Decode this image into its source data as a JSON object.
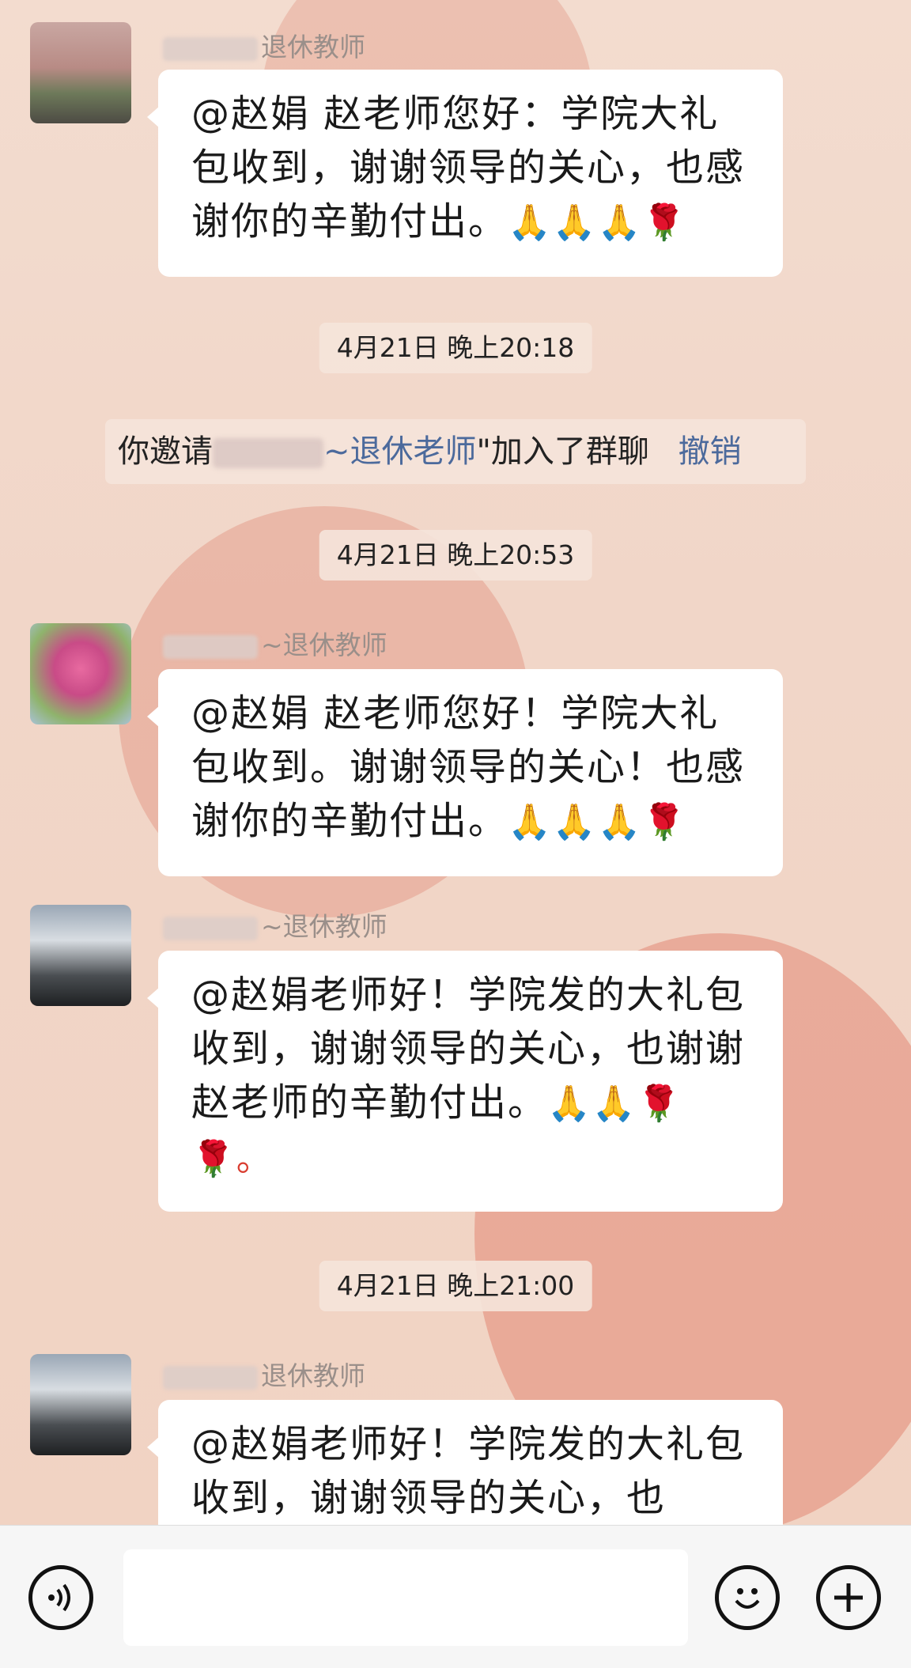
{
  "messages": [
    {
      "sender_suffix": "退休教师",
      "text": "@赵娟  赵老师您好：学院大礼包收到，谢谢领导的关心，也感谢你的辛勤付出。",
      "emoji": "🙏🙏🙏🌹"
    },
    {
      "sender_suffix": "~退休教师",
      "text": "@赵娟  赵老师您好！学院大礼包收到。谢谢领导的关心！也感谢你的辛勤付出。",
      "emoji": "🙏🙏🙏🌹"
    },
    {
      "sender_suffix": "~退休教师",
      "text": "@赵娟老师好！学院发的大礼包收到，谢谢领导的关心，也谢谢赵老师的辛勤付出。",
      "emoji": "🙏🙏🌹🌹。"
    },
    {
      "sender_suffix": "退休教师",
      "text": "@赵娟老师好！学院发的大礼包收到，谢谢领导的关心，也"
    }
  ],
  "timestamps": [
    "4月21日 晚上20:18",
    "4月21日 晚上20:53",
    "4月21日 晚上21:00"
  ],
  "system_message": {
    "prefix": "你邀请",
    "name_suffix": "~退休老师",
    "suffix": "\"加入了群聊",
    "action": "撤销"
  },
  "input_bar": {
    "voice_icon": "voice-icon",
    "emoji_icon": "emoji-icon",
    "plus_icon": "plus-icon"
  }
}
